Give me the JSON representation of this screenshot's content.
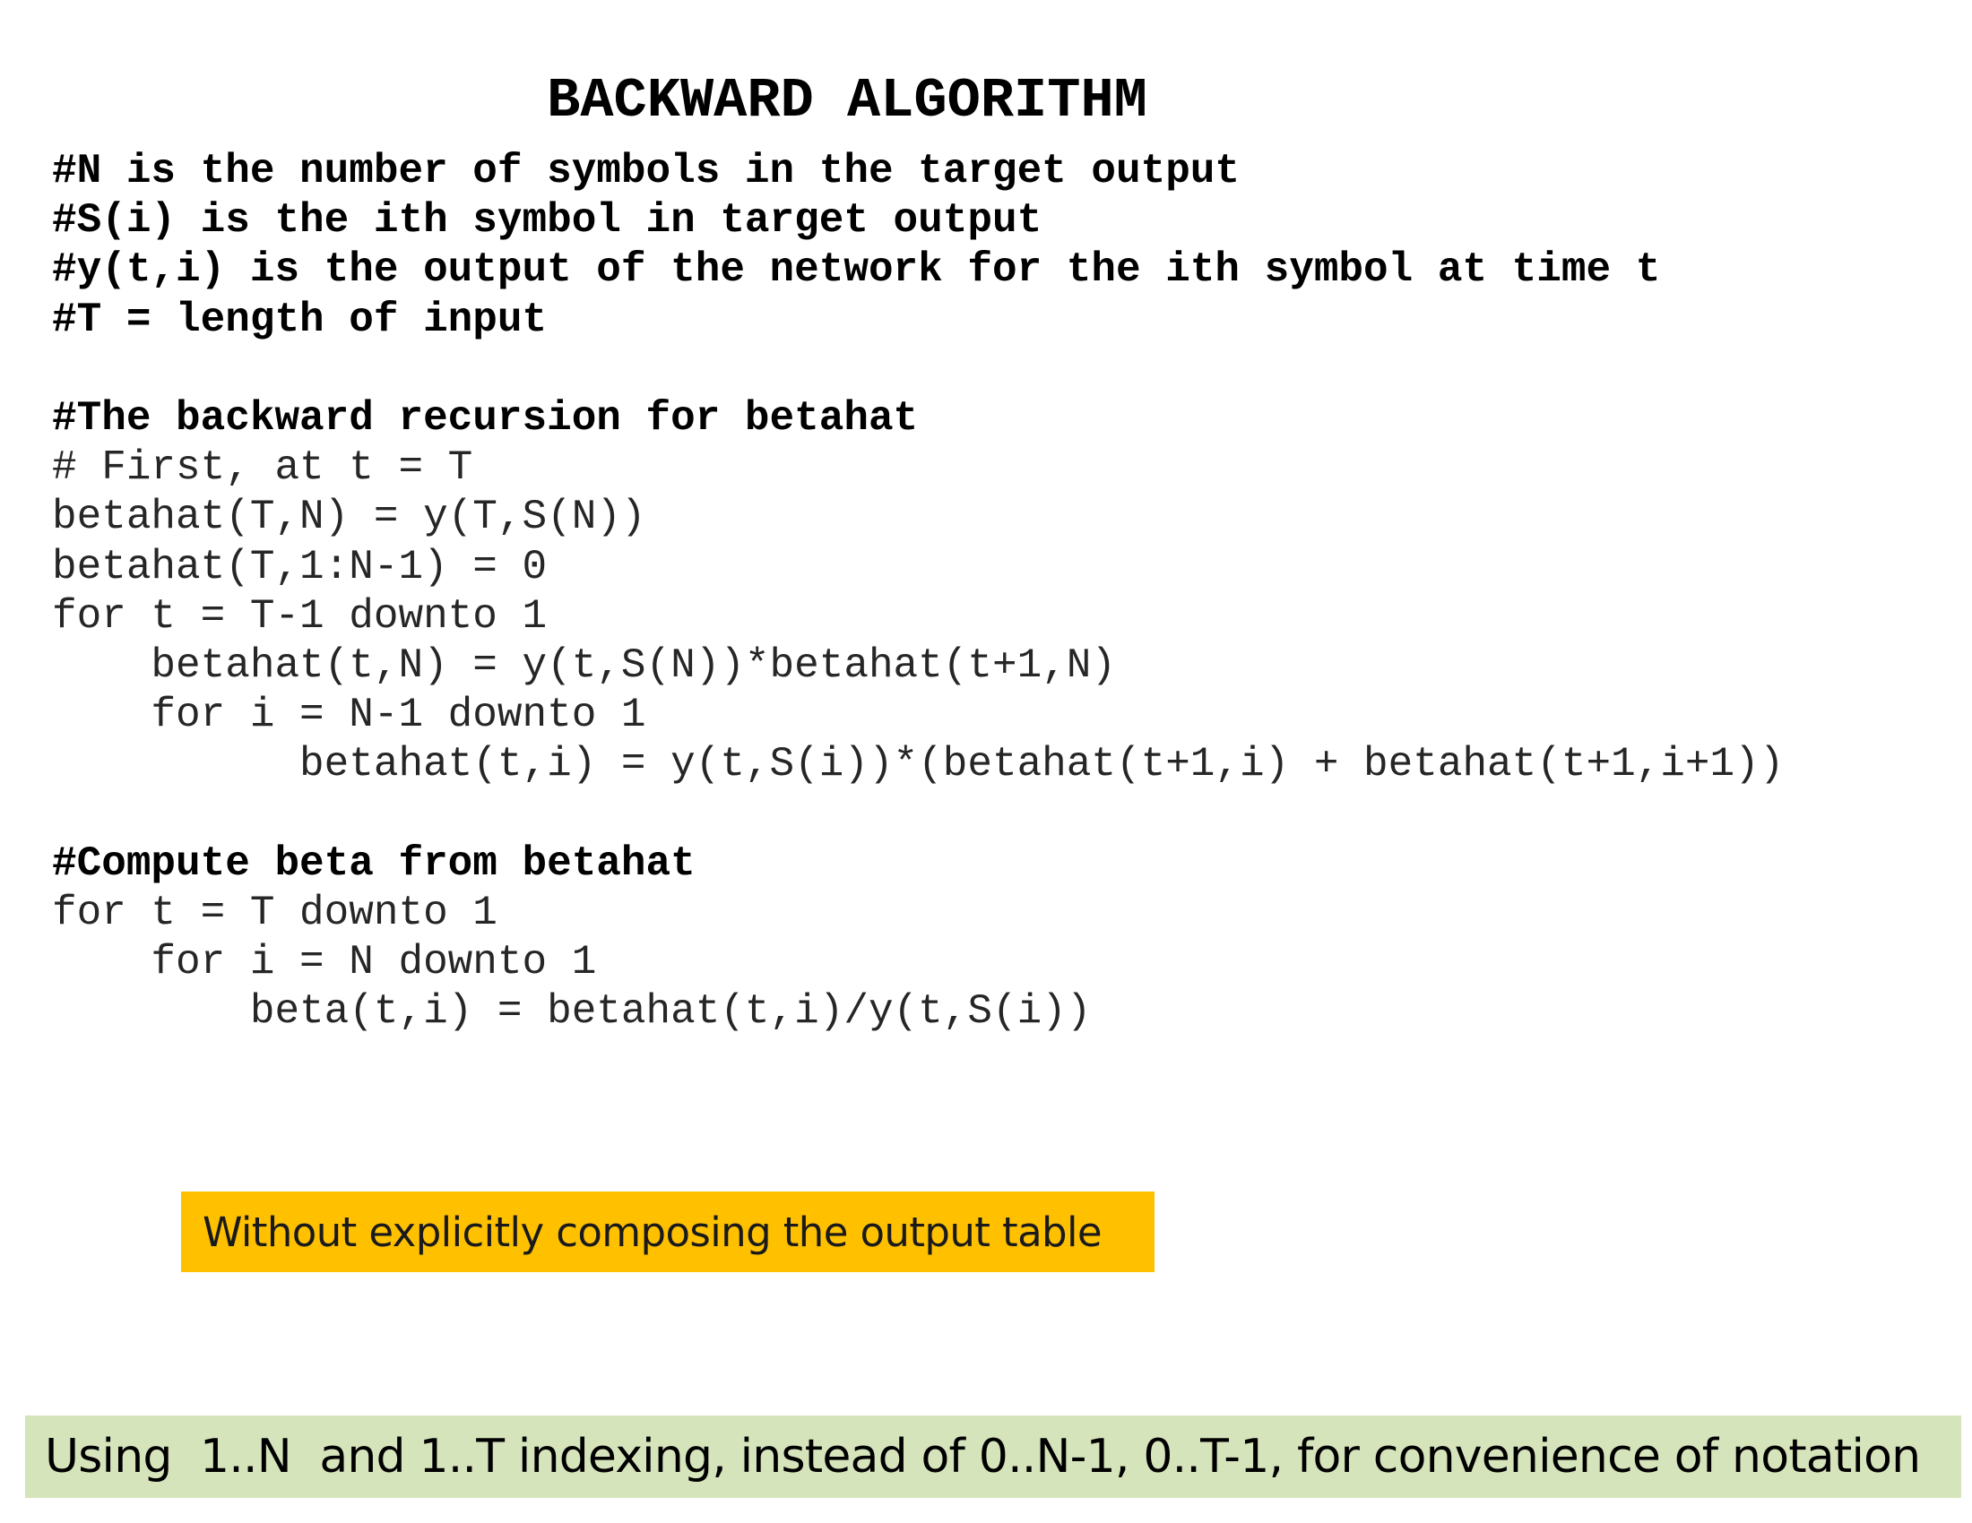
{
  "title": "BACKWARD ALGORITHM",
  "code": {
    "lines": [
      {
        "text": "#N is the number of symbols in the target output",
        "bold": true
      },
      {
        "text": "#S(i) is the ith symbol in target output",
        "bold": true
      },
      {
        "text": "#y(t,i) is the output of the network for the ith symbol at time t",
        "bold": true
      },
      {
        "text": "#T = length of input",
        "bold": true
      },
      {
        "text": "",
        "bold": false
      },
      {
        "text": "#The backward recursion for betahat",
        "bold": true
      },
      {
        "text": "# First, at t = T",
        "bold": false
      },
      {
        "text": "betahat(T,N) = y(T,S(N))",
        "bold": false
      },
      {
        "text": "betahat(T,1:N-1) = 0",
        "bold": false
      },
      {
        "text": "for t = T-1 downto 1",
        "bold": false
      },
      {
        "text": "    betahat(t,N) = y(t,S(N))*betahat(t+1,N)",
        "bold": false
      },
      {
        "text": "    for i = N-1 downto 1",
        "bold": false
      },
      {
        "text": "          betahat(t,i) = y(t,S(i))*(betahat(t+1,i) + betahat(t+1,i+1))",
        "bold": false
      },
      {
        "text": "",
        "bold": false
      },
      {
        "text": "#Compute beta from betahat",
        "bold": true
      },
      {
        "text": "for t = T downto 1",
        "bold": false
      },
      {
        "text": "    for i = N downto 1",
        "bold": false
      },
      {
        "text": "        beta(t,i) = betahat(t,i)/y(t,S(i))",
        "bold": false
      }
    ]
  },
  "callout_note": "Without explicitly composing the output table",
  "footer_note": "Using  1..N  and 1..T indexing, instead of 0..N-1, 0..T-1, for convenience of notation",
  "colors": {
    "callout_note_bg": "#ffc000",
    "footer_note_bg": "#d6e4bc"
  }
}
